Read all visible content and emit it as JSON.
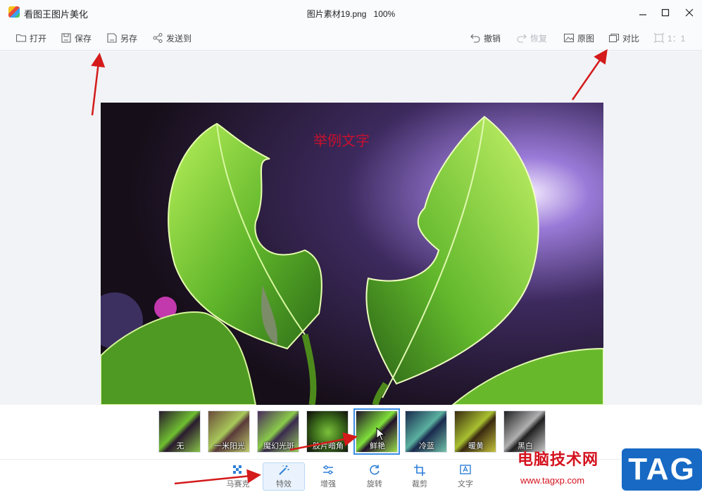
{
  "window": {
    "app_title": "看图王图片美化",
    "doc_title": "图片素材19.png",
    "zoom": "100%"
  },
  "toolbar": {
    "open": "打开",
    "save": "保存",
    "save_as": "另存",
    "send_to": "发送到",
    "undo": "撤销",
    "redo": "恢复",
    "original": "原图",
    "compare": "对比",
    "ratio": "1：1"
  },
  "canvas": {
    "overlay_text": "举例文字"
  },
  "filters": [
    {
      "label": "无",
      "tint": "none"
    },
    {
      "label": "一米阳光",
      "tint": "#f3c27a"
    },
    {
      "label": "魔幻光斑",
      "tint": "#c87adb"
    },
    {
      "label": "胶片暗角",
      "tint": "#202020"
    },
    {
      "label": "鲜艳",
      "tint": "#7be04a",
      "selected": true
    },
    {
      "label": "冷蓝",
      "tint": "#4a90e2"
    },
    {
      "label": "暖黄",
      "tint": "#e2b04a"
    },
    {
      "label": "黑白",
      "tint": "gray"
    }
  ],
  "bottom_tools": [
    {
      "label": "马赛克",
      "icon": "mosaic-icon"
    },
    {
      "label": "特效",
      "icon": "magic-wand-icon",
      "active": true
    },
    {
      "label": "增强",
      "icon": "sliders-icon"
    },
    {
      "label": "旋转",
      "icon": "rotate-icon"
    },
    {
      "label": "裁剪",
      "icon": "crop-icon"
    },
    {
      "label": "文字",
      "icon": "text-icon"
    }
  ],
  "watermark": {
    "site_name": "电脑技术网",
    "url": "www.tagxp.com",
    "badge": "TAG"
  },
  "colors": {
    "accent": "#3a8ee6",
    "annotation_red": "#d41a1a",
    "overlay_text": "#c8102e"
  }
}
